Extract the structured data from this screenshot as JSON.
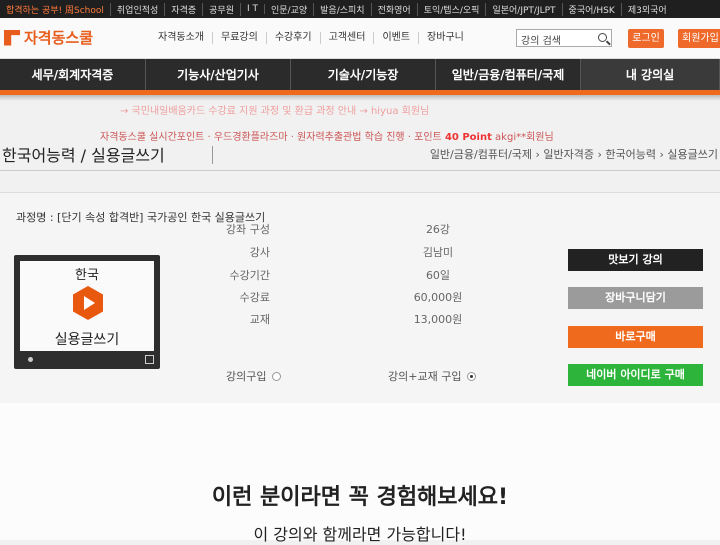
{
  "topbar": {
    "items": [
      "합격하는 공부! 周School",
      "취업인적성",
      "자격증",
      "공무원",
      "I T",
      "인문/교양",
      "발음/스피치",
      "전화영어",
      "토익/텝스/오픽",
      "일본어/JPT/JLPT",
      "중국어/HSK",
      "제3외국어"
    ]
  },
  "header": {
    "logo": "자격동스쿨",
    "gnb": [
      "자격동소개",
      "무료강의",
      "수강후기",
      "고객센터",
      "이벤트",
      "장바구니"
    ],
    "search_placeholder": "강의 검색",
    "login": "로그인",
    "join": "회원가입"
  },
  "mainnav": [
    "세무/회계자격증",
    "기능사/산업기사",
    "기술사/기능장",
    "일반/금융/컴퓨터/국제",
    "내 강의실"
  ],
  "ticker": {
    "line1": "→ 국민내일배움카드 수강료 지원 과정 및 환급 과정 안내 → hiyua 회원님",
    "line2_text": "자격동스쿨 실시간포인트 · 우드경환플라즈마 · 원자력추출관법 학습 진행 · 포인트 ",
    "line2_point": "40 Point",
    "line2_user": " akgi**회원님"
  },
  "page": {
    "title": "한국어능력 / 실용글쓰기",
    "breadcrumb": "일반/금융/컴퓨터/국제 › 일반자격증 › 한국어능력 › 실용글쓰기"
  },
  "course": {
    "name": "과정명 : [단기 속성 합격반] 국가공인 한국 실용글쓰기",
    "thumb_top": "한국",
    "thumb_bottom": "실용글쓰기",
    "info": [
      {
        "label": "강좌 구성",
        "value": "26강"
      },
      {
        "label": "강사",
        "value": "김남미"
      },
      {
        "label": "수강기간",
        "value": "60일"
      },
      {
        "label": "수강료",
        "value": "60,000원"
      },
      {
        "label": "교재",
        "value": "13,000원"
      }
    ],
    "option1": "강의구입",
    "option2": "강의+교재 구입",
    "selected_option": "강의+교재 구입"
  },
  "buttons": {
    "sample": "맛보기 강의",
    "cart": "장바구니담기",
    "buy": "바로구매",
    "naver": "네이버 아이디로 구매"
  },
  "promo": {
    "headline": "이런 분이라면 꼭 경험해보세요!",
    "subline": "이 강의와 함께라면 가능합니다!"
  },
  "colors": {
    "accent": "#f06a1e",
    "nav_bg": "#2b2b2b",
    "naver_green": "#2db43a"
  }
}
